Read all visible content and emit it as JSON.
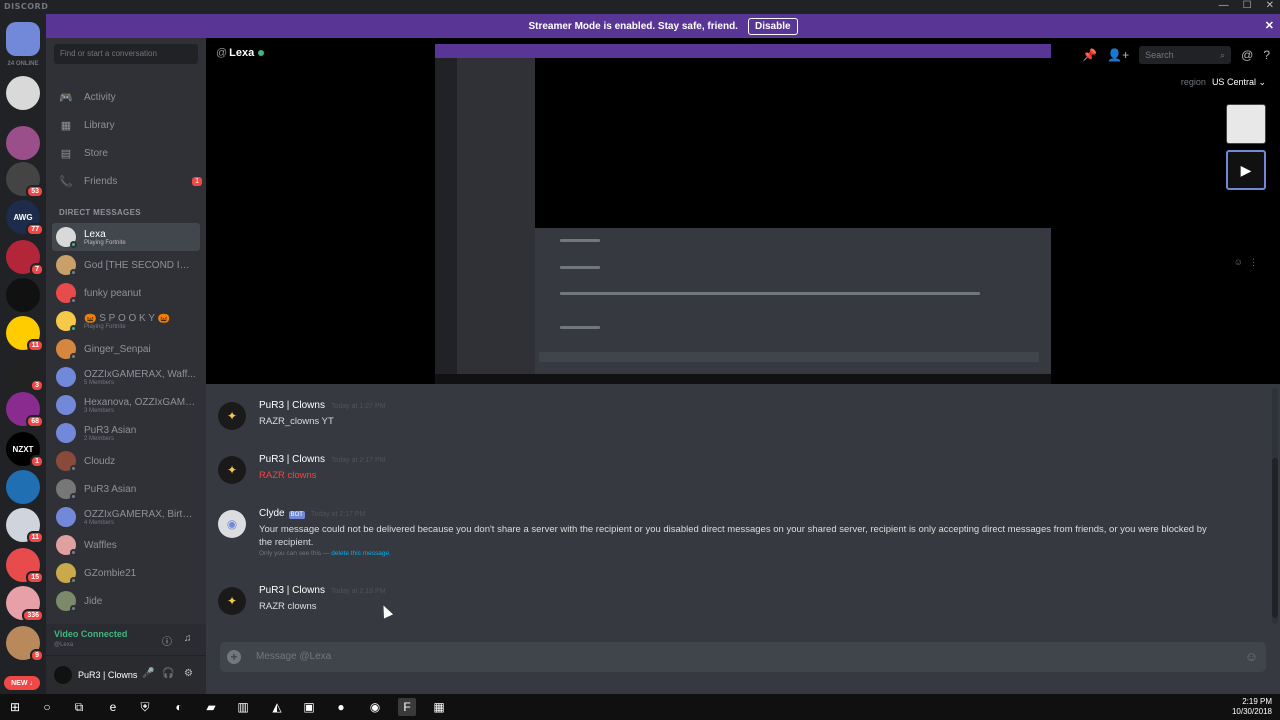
{
  "app": {
    "name": "DISCORD"
  },
  "window": {
    "controls": [
      "—",
      "☐",
      "✕"
    ]
  },
  "streamer": {
    "message": "Streamer Mode is enabled. Stay safe, friend.",
    "disable_label": "Disable",
    "close": "✕"
  },
  "guilds": {
    "online_count": "24 ONLINE",
    "items": [
      {
        "label": "",
        "color": "#7289da",
        "badge": ""
      },
      {
        "label": "",
        "color": "#d9d9d9",
        "badge": ""
      },
      {
        "label": "",
        "color": "#9b4f8a",
        "badge": ""
      },
      {
        "label": "",
        "color": "#444444",
        "badge": "53"
      },
      {
        "label": "AWG",
        "color": "#1d2c4a",
        "badge": "77"
      },
      {
        "label": "",
        "color": "#b3263a",
        "badge": "7"
      },
      {
        "label": "",
        "color": "#111111",
        "badge": ""
      },
      {
        "label": "",
        "color": "#ffcc00",
        "badge": "11"
      },
      {
        "label": "",
        "color": "#222222",
        "badge": "3"
      },
      {
        "label": "",
        "color": "#8a2b8f",
        "badge": "68"
      },
      {
        "label": "NZXT",
        "color": "#000000",
        "badge": "1"
      },
      {
        "label": "",
        "color": "#1f6fb2",
        "badge": ""
      },
      {
        "label": "",
        "color": "#d0d4dc",
        "badge": "11"
      },
      {
        "label": "",
        "color": "#e84b4b",
        "badge": "15"
      },
      {
        "label": "",
        "color": "#e8a0a8",
        "badge": "336"
      },
      {
        "label": "",
        "color": "#b9895b",
        "badge": "9"
      }
    ],
    "new_label": "NEW ↓"
  },
  "sidebar": {
    "search_placeholder": "Find or start a conversation",
    "nav": [
      {
        "label": "Activity",
        "icon": "gamepad-icon",
        "glyph": "🎮",
        "count": ""
      },
      {
        "label": "Library",
        "icon": "library-icon",
        "glyph": "▦",
        "count": ""
      },
      {
        "label": "Store",
        "icon": "store-icon",
        "glyph": "▤",
        "count": ""
      },
      {
        "label": "Friends",
        "icon": "friends-icon",
        "glyph": "📞",
        "count": "1"
      }
    ],
    "dm_header": "DIRECT MESSAGES",
    "dms": [
      {
        "name": "Lexa",
        "sub": "Playing Fortnite",
        "color": "#d9d9d9",
        "status": "#43b581",
        "active": true
      },
      {
        "name": "God [THE SECOND INC...",
        "sub": "",
        "color": "#caa06a",
        "status": "#747f8d"
      },
      {
        "name": "funky peanut",
        "sub": "",
        "color": "#e84b4b",
        "status": "#747f8d"
      },
      {
        "name": "🎃 S P O O K Y 🎃",
        "sub": "Playing Fortnite",
        "color": "#f7c948",
        "status": "#43b581"
      },
      {
        "name": "Ginger_Senpai",
        "sub": "",
        "color": "#d5863f",
        "status": "#747f8d"
      },
      {
        "name": "OZZIxGAMERAX, Waff...",
        "sub": "5 Members",
        "color": "#7289da",
        "status": ""
      },
      {
        "name": "Hexanova, OZZIxGAME...",
        "sub": "3 Members",
        "color": "#7289da",
        "status": ""
      },
      {
        "name": "PuR3 Asian",
        "sub": "2 Members",
        "color": "#7289da",
        "status": ""
      },
      {
        "name": "Cloudz",
        "sub": "",
        "color": "#8a4a3a",
        "status": "#747f8d"
      },
      {
        "name": "PuR3 Asian",
        "sub": "",
        "color": "#777777",
        "status": "#747f8d"
      },
      {
        "name": "OZZIxGAMERAX, Birth...",
        "sub": "4 Members",
        "color": "#7289da",
        "status": ""
      },
      {
        "name": "Waffles",
        "sub": "",
        "color": "#e0a0a0",
        "status": "#747f8d"
      },
      {
        "name": "GZombie21",
        "sub": "",
        "color": "#c9a94a",
        "status": "#747f8d"
      },
      {
        "name": "Jide",
        "sub": "",
        "color": "#7a8a6a",
        "status": "#747f8d"
      }
    ],
    "voice": {
      "status": "Video Connected",
      "sub": "@Lexa",
      "icons": [
        "ⓘ",
        "♫"
      ]
    },
    "user": {
      "name": "PuR3 | Clowns",
      "icons": [
        "🎤",
        "🎧",
        "⚙"
      ]
    }
  },
  "chat": {
    "title": "Lexa",
    "at": "@",
    "search_placeholder": "Search",
    "top_icons": [
      "📌",
      "👤+",
      "@",
      "?"
    ],
    "region_label": "region",
    "region_value": "US Central ⌄",
    "messages": [
      {
        "author": "PuR3 | Clowns",
        "time": "Today at 1:27 PM",
        "text": "RAZR_clowns YT",
        "red": false,
        "bot": false
      },
      {
        "author": "PuR3 | Clowns",
        "time": "Today at 2:17 PM",
        "text": "RAZR clowns",
        "red": true,
        "bot": false
      },
      {
        "author": "Clyde",
        "bot_tag": "BOT",
        "time": "Today at 2:17 PM",
        "text": "Your message could not be delivered because you don't share a server with the recipient or you disabled direct messages on your shared server, recipient is only accepting direct messages from friends, or you were blocked by the recipient.",
        "note": "Only you can see this — ",
        "note_link": "delete this message.",
        "red": false,
        "bot": true
      },
      {
        "author": "PuR3 | Clowns",
        "time": "Today at 2:18 PM",
        "text": "RAZR clowns",
        "red": false,
        "bot": false
      }
    ],
    "composer_placeholder": "Message @Lexa"
  },
  "taskbar": {
    "icons": [
      {
        "name": "start-icon",
        "glyph": "⊞"
      },
      {
        "name": "cortana-icon",
        "glyph": "○"
      },
      {
        "name": "task-view-icon",
        "glyph": "⧉"
      },
      {
        "name": "edge-icon",
        "glyph": "e"
      },
      {
        "name": "defender-icon",
        "glyph": "⛨"
      },
      {
        "name": "steam-icon",
        "glyph": "◐"
      },
      {
        "name": "explorer-icon",
        "glyph": "▰"
      },
      {
        "name": "app-icon",
        "glyph": "▥"
      },
      {
        "name": "app-icon-2",
        "glyph": "◭"
      },
      {
        "name": "app-icon-3",
        "glyph": "▣"
      },
      {
        "name": "spotify-icon",
        "glyph": "●"
      },
      {
        "name": "discord-icon",
        "glyph": "◉"
      },
      {
        "name": "fortnite-icon",
        "glyph": "F"
      },
      {
        "name": "app-icon-4",
        "glyph": "▦"
      }
    ],
    "time": "2:19 PM",
    "date": "10/30/2018"
  }
}
